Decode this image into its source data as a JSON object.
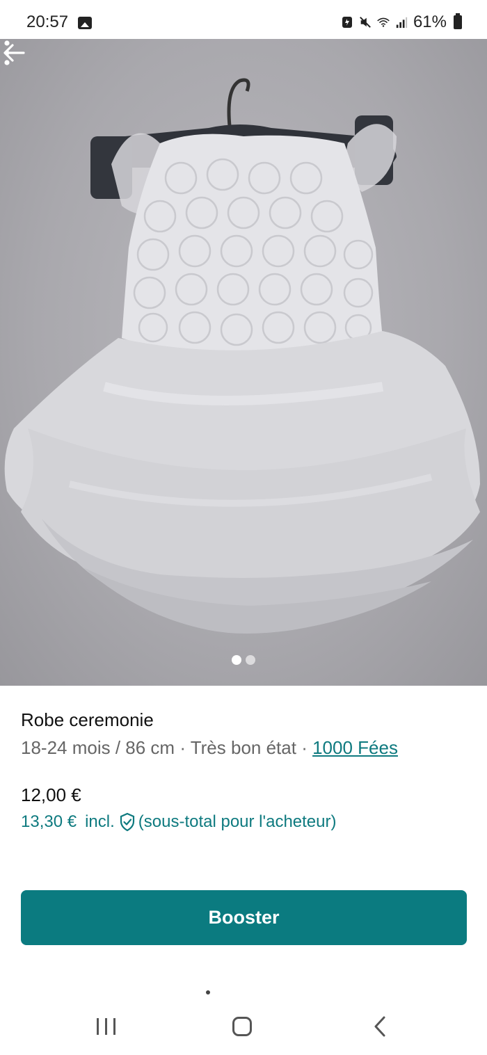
{
  "status_bar": {
    "time": "20:57",
    "battery": "61%",
    "icons": [
      "gallery-icon",
      "data-saver-icon",
      "mute-icon",
      "wifi-icon",
      "signal-icon",
      "battery-icon"
    ]
  },
  "photo": {
    "image_count": 2,
    "active_index": 0,
    "background_color": "#a9a8ad",
    "description_icon": "dress-photo"
  },
  "listing": {
    "title": "Robe ceremonie",
    "size": "18-24 mois / 86 cm",
    "separator1": " · ",
    "condition": "Très bon état",
    "separator2": " · ",
    "brand": "1000 Fées",
    "price": "12,00 €",
    "buyer_price": "13,30 €",
    "incl_label": "incl.",
    "buyer_note": "(sous-total pour l'acheteur)"
  },
  "actions": {
    "booster_label": "Booster"
  },
  "colors": {
    "accent": "#0b7b80",
    "link": "#0e7a7f"
  }
}
